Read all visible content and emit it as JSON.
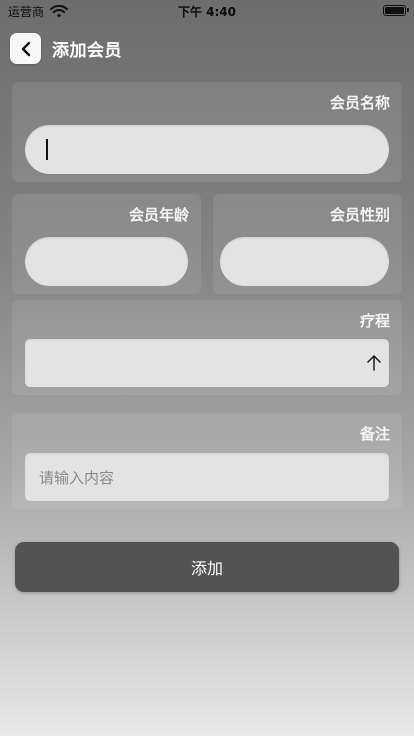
{
  "status_bar": {
    "carrier": "运营商",
    "time": "下午 4:40"
  },
  "header": {
    "title": "添加会员",
    "back_icon": "chevron-left-icon"
  },
  "form": {
    "member_name_label": "会员名称",
    "member_name_value": "",
    "member_age_label": "会员年龄",
    "member_age_value": "",
    "member_gender_label": "会员性别",
    "member_gender_value": "",
    "course_label": "疗程",
    "course_value": "",
    "course_dropdown_icon": "up-arrow-icon",
    "notes_label": "备注",
    "notes_placeholder": "请输入内容"
  },
  "submit_label": "添加",
  "colors": {
    "background_top": "#6d6d6d",
    "background_bottom": "#e8e8e8",
    "card_overlay": "rgba(255,255,255,0.09)",
    "input_fill": "#e3e3e3",
    "submit_fill": "#535353",
    "text_light": "#ffffff"
  }
}
